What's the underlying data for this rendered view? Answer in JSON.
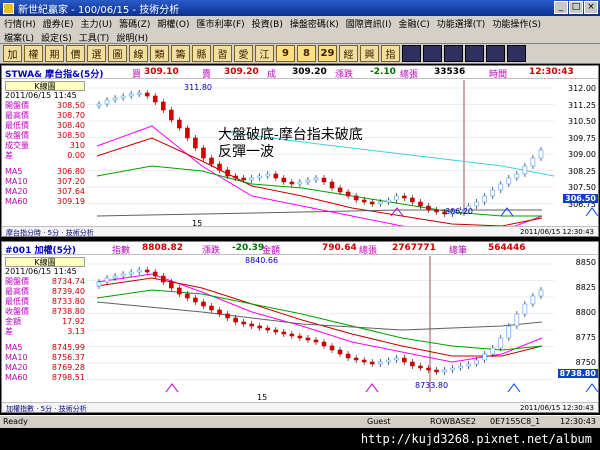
{
  "window": {
    "title": "新世紀贏家 - 100/06/15 - 技術分析"
  },
  "menu": {
    "row1": [
      "行情(H)",
      "證券(E)",
      "主力(U)",
      "籌碼(Z)",
      "期權(O)",
      "匯市利率(F)",
      "投資(B)",
      "操盤密碼(K)",
      "國際資訊(I)",
      "金融(C)",
      "功能選擇(T)",
      "功能操作(S)"
    ],
    "row2": [
      "檔案(L)",
      "設定(S)",
      "工具(T)",
      "說明(H)"
    ]
  },
  "toolbar": {
    "buttons": [
      "加",
      "權",
      "期",
      "價",
      "選",
      "圖",
      "線",
      "類",
      "籌",
      "縣",
      "習",
      "愛",
      "江",
      "9",
      "8",
      "29",
      "經",
      "興",
      "指",
      "",
      "",
      "",
      "",
      "",
      ""
    ]
  },
  "panel1": {
    "symbol": "STWA& 摩台指&(5分)",
    "buy_label": "買",
    "buy": "309.10",
    "sell_label": "賣",
    "sell": "309.20",
    "last_label": "成",
    "last": "309.20",
    "chg_label": "漲跌",
    "chg": "-2.10",
    "vol_label": "總張",
    "vol": "33536",
    "time_label": "時間",
    "time": "12:30:43",
    "k_title": "K線圖",
    "date": "2011/06/15 11:45",
    "info": [
      {
        "k": "開盤價",
        "v": "308.50"
      },
      {
        "k": "最高價",
        "v": "308.70"
      },
      {
        "k": "最低價",
        "v": "308.40"
      },
      {
        "k": "收盤價",
        "v": "308.50"
      },
      {
        "k": "成交量",
        "v": "310"
      },
      {
        "k": "差",
        "v": "0.00"
      }
    ],
    "ma": [
      {
        "k": "MA5",
        "v": "306.80"
      },
      {
        "k": "MA10",
        "v": "307.20"
      },
      {
        "k": "MA20",
        "v": "307.64"
      },
      {
        "k": "MA60",
        "v": "309.19"
      }
    ],
    "yticks": [
      "312.00",
      "311.25",
      "310.50",
      "309.75",
      "309.00",
      "308.25",
      "307.50",
      "306.75"
    ],
    "ytag": "306.50",
    "high_label": "311.80",
    "low_label": "306.20",
    "x_label": "15",
    "foot_left": "摩台指分時 · 5分 · 技術分析",
    "foot_right": "2011/06/15 12:30:43"
  },
  "annotation": {
    "line1": "大盤破底-摩台指未破底",
    "line2": "反彈一波"
  },
  "panel2": {
    "symbol": "#001 加權(5分)",
    "idx_label": "指數",
    "idx": "8808.82",
    "chg_label": "漲跌",
    "chg": "-20.39",
    "amt_label": "金額",
    "amt": "790.64",
    "vol_label": "總張",
    "vol": "2767771",
    "cnt_label": "總筆",
    "cnt": "564446",
    "k_title": "K線圖",
    "date": "2011/06/15 11:45",
    "info": [
      {
        "k": "開盤價",
        "v": "8734.74"
      },
      {
        "k": "最高價",
        "v": "8739.40"
      },
      {
        "k": "最低價",
        "v": "8733.80"
      },
      {
        "k": "收盤價",
        "v": "8738.80"
      },
      {
        "k": "金額",
        "v": "17.92"
      },
      {
        "k": "差",
        "v": "3.13"
      }
    ],
    "ma": [
      {
        "k": "MA5",
        "v": "8745.99"
      },
      {
        "k": "MA10",
        "v": "8756.37"
      },
      {
        "k": "MA20",
        "v": "8769.28"
      },
      {
        "k": "MA60",
        "v": "8798.51"
      }
    ],
    "yticks": [
      "8850",
      "8825",
      "8800",
      "8775",
      "8750"
    ],
    "ytag": "8738.80",
    "high_label": "8840.66",
    "low_label": "8733.80",
    "x_label": "15",
    "foot_left": "加權指數 · 5分 · 技術分析",
    "foot_right": "2011/06/15 12:30:43"
  },
  "status": {
    "ready": "Ready",
    "user": "Guest",
    "server": "ROWBASE2",
    "code": "0E7155C8_1",
    "time": "12:30:43"
  },
  "url": "http://kujd3268.pixnet.net/album",
  "colors": {
    "up": "#d00000",
    "down": "#008000",
    "ma5": "#ff00ff",
    "ma10": "#c00000",
    "ma20": "#00a000",
    "ma60": "#606060",
    "accent_blue": "#1040c0"
  }
}
